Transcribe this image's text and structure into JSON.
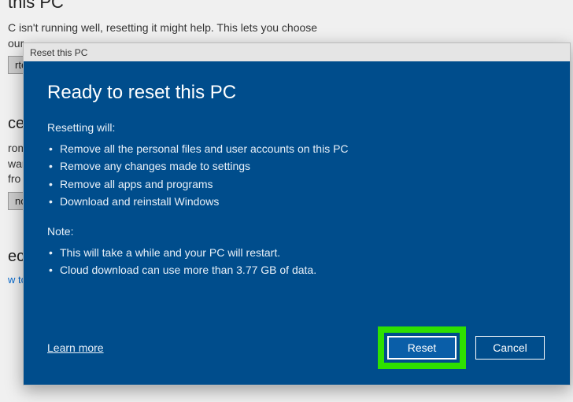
{
  "bg": {
    "heading": "this PC",
    "text_line1": "C isn't running well, resetting it might help. This lets you choose",
    "text_line2": "our",
    "btn_started": "rted",
    "sub_advanced": "ced",
    "text_from": "rom",
    "text_ware": "ware",
    "text_fro": "fro",
    "btn_now": "now",
    "sub_reco": "eco",
    "link_wto": "w to"
  },
  "dialog": {
    "window_title": "Reset this PC",
    "title": "Ready to reset this PC",
    "resetting_label": "Resetting will:",
    "resetting_items": [
      "Remove all the personal files and user accounts on this PC",
      "Remove any changes made to settings",
      "Remove all apps and programs",
      "Download and reinstall Windows"
    ],
    "note_label": "Note:",
    "note_items": [
      "This will take a while and your PC will restart.",
      "Cloud download can use more than 3.77 GB of data."
    ],
    "learn_more": "Learn more",
    "reset_btn": "Reset",
    "cancel_btn": "Cancel"
  }
}
